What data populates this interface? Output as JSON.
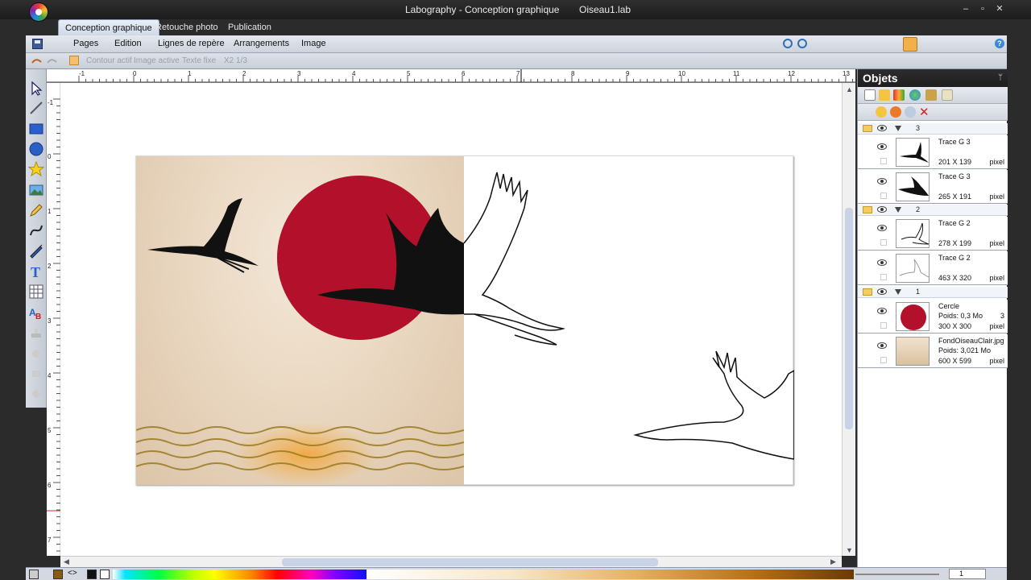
{
  "window": {
    "title": "Labography - Conception graphique",
    "document": "Oiseau1.lab",
    "minimize": "‒",
    "maximize": "▫",
    "close": "✕"
  },
  "tabs": [
    {
      "label": "Conception graphique",
      "active": true
    },
    {
      "label": "Retouche photo",
      "active": false
    },
    {
      "label": "Publication",
      "active": false
    }
  ],
  "menu": [
    "Pages",
    "Edition",
    "Lignes de repère",
    "Arrangements",
    "Image"
  ],
  "help_label": "?",
  "options": {
    "contour_actif": "Contour actif",
    "image_active": "Image active",
    "texte_fixe": "Texte fixe",
    "page_counter": "X2  1/3"
  },
  "ruler_h": [
    "-1",
    "0",
    "1",
    "2",
    "3",
    "4",
    "5",
    "6",
    "7",
    "8",
    "9",
    "10",
    "11",
    "12",
    "13"
  ],
  "ruler_v": [
    "-1",
    "0",
    "1",
    "2",
    "3",
    "4",
    "5",
    "6",
    "7"
  ],
  "objects_panel": {
    "title": "Objets",
    "pin": "ᛘ",
    "delete": "✕",
    "groups": [
      {
        "number": "3",
        "items": [
          {
            "name": "Trace G 3",
            "size": "201  X  139",
            "unit": "pixel"
          },
          {
            "name": "Trace G 3",
            "size": "265  X  191",
            "unit": "pixel"
          }
        ]
      },
      {
        "number": "2",
        "items": [
          {
            "name": "Trace G 2",
            "size": "278  X  199",
            "unit": "pixel"
          },
          {
            "name": "Trace G 2",
            "size": "463  X  320",
            "unit": "pixel"
          }
        ]
      },
      {
        "number": "1",
        "items": [
          {
            "name": "Cercle",
            "sub": "Poids: 0,3 Mo",
            "extra": "3",
            "size": "300  X  300",
            "unit": "pixel"
          },
          {
            "name": "FondOiseauClair.jpg",
            "sub": "Poids: 3,021 Mo",
            "size": "600  X  599",
            "unit": "pixel"
          }
        ]
      }
    ]
  },
  "bottom": {
    "nav_code": "<>",
    "page_value": "1"
  },
  "colors": {
    "circle_red": "#b3102b",
    "accent_blue": "#2e6fb5"
  }
}
